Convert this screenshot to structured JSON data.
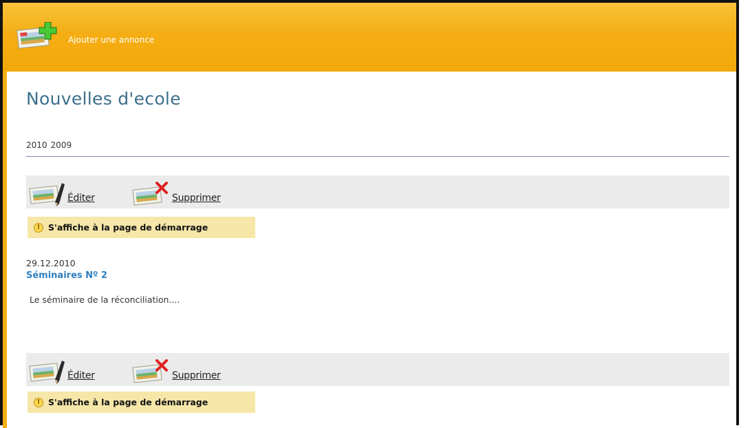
{
  "header": {
    "add_label": "Ajouter une annonce"
  },
  "page": {
    "title": "Nouvelles d'ecole"
  },
  "years": [
    "2010",
    "2009"
  ],
  "actions": {
    "edit_label": "Éditer",
    "delete_label": "Supprimer"
  },
  "notice": {
    "text": "S'affiche à la page de démarrage",
    "icon": "exclamation-icon"
  },
  "news": [
    {
      "date": "29.12.2010",
      "title": "Séminaires Nº 2",
      "excerpt": "Le séminaire de la réconciliation...."
    }
  ],
  "colors": {
    "header": "#f4ae14",
    "title": "#3d6f8c",
    "link": "#2f7fbf",
    "notice_bg": "#f6e7a9",
    "bar_bg": "#ebebeb"
  }
}
